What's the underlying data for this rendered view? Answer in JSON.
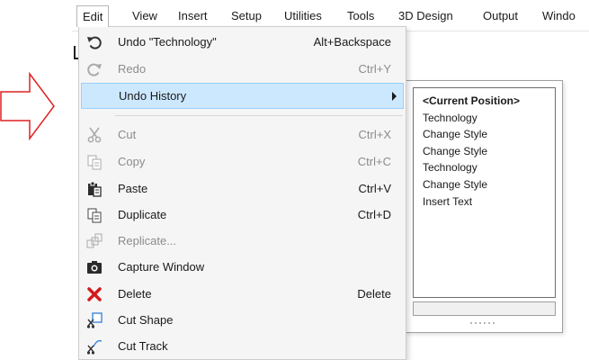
{
  "menubar": {
    "items": [
      {
        "label": "Edit"
      },
      {
        "label": "View"
      },
      {
        "label": "Insert"
      },
      {
        "label": "Setup"
      },
      {
        "label": "Utilities"
      },
      {
        "label": "Tools"
      },
      {
        "label": "3D Design"
      },
      {
        "label": "Output"
      },
      {
        "label": "Windo"
      }
    ]
  },
  "edit_menu": {
    "items": [
      {
        "label": "Undo \"Technology\"",
        "shortcut": "Alt+Backspace",
        "icon": "undo-icon",
        "enabled": true
      },
      {
        "label": "Redo",
        "shortcut": "Ctrl+Y",
        "icon": "redo-icon",
        "enabled": false
      },
      {
        "label": "Undo History",
        "shortcut": "",
        "icon": "",
        "enabled": true,
        "highlighted": true,
        "submenu": true
      },
      {
        "label": "Cut",
        "shortcut": "Ctrl+X",
        "icon": "cut-icon",
        "enabled": false
      },
      {
        "label": "Copy",
        "shortcut": "Ctrl+C",
        "icon": "copy-icon",
        "enabled": false
      },
      {
        "label": "Paste",
        "shortcut": "Ctrl+V",
        "icon": "paste-icon",
        "enabled": true
      },
      {
        "label": "Duplicate",
        "shortcut": "Ctrl+D",
        "icon": "duplicate-icon",
        "enabled": true
      },
      {
        "label": "Replicate...",
        "shortcut": "",
        "icon": "replicate-icon",
        "enabled": false
      },
      {
        "label": "Capture Window",
        "shortcut": "",
        "icon": "camera-icon",
        "enabled": true
      },
      {
        "label": "Delete",
        "shortcut": "Delete",
        "icon": "delete-icon",
        "enabled": true
      },
      {
        "label": "Cut Shape",
        "shortcut": "",
        "icon": "cut-shape-icon",
        "enabled": true
      },
      {
        "label": "Cut Track",
        "shortcut": "",
        "icon": "cut-track-icon",
        "enabled": true
      }
    ]
  },
  "undo_history": {
    "items": [
      "<Current Position>",
      "Technology",
      "Change Style",
      "Change Style",
      "Technology",
      "Change Style",
      "Insert Text"
    ]
  },
  "colors": {
    "highlight_bg": "#cce8ff",
    "highlight_border": "#99d1ff",
    "arrow": "#e02020",
    "delete_red": "#d31a1a",
    "disabled_text": "#8c8c8c"
  }
}
